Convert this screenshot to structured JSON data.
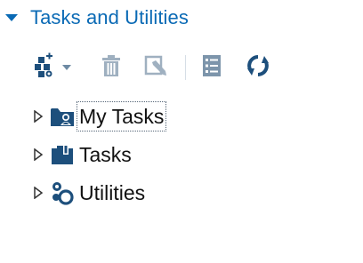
{
  "panel": {
    "title": "Tasks and Utilities",
    "accent_color": "#0a6ab5",
    "icon_color": "#1d4f7c",
    "collapse_icon": "triangle-down-icon"
  },
  "toolbar": {
    "buttons": [
      {
        "name": "new-menu",
        "icon": "new-task-icon",
        "has_dropdown": true
      },
      {
        "name": "delete",
        "icon": "trash-icon"
      },
      {
        "name": "edit",
        "icon": "edit-pencil-icon"
      },
      {
        "name": "properties",
        "icon": "properties-list-icon"
      },
      {
        "name": "refresh",
        "icon": "refresh-icon"
      }
    ]
  },
  "tree": {
    "items": [
      {
        "label": "My Tasks",
        "icon": "folder-user-icon",
        "expanded": false,
        "focused": true
      },
      {
        "label": "Tasks",
        "icon": "task-book-icon",
        "expanded": false,
        "focused": false
      },
      {
        "label": "Utilities",
        "icon": "utilities-gears-icon",
        "expanded": false,
        "focused": false
      }
    ]
  }
}
